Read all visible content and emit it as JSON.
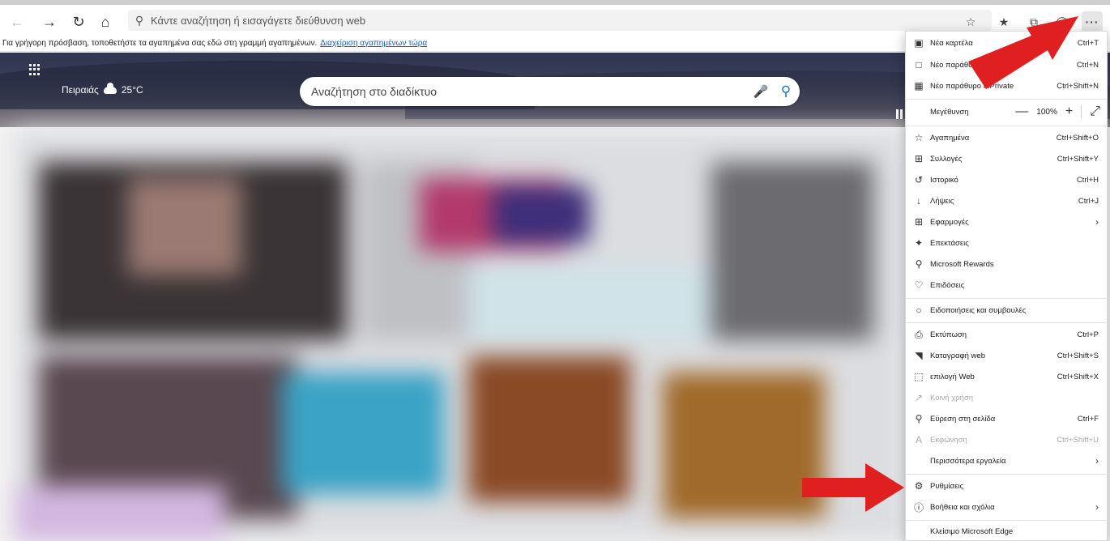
{
  "address_bar": {
    "placeholder": "Κάντε αναζήτηση ή εισαγάγετε διεύθυνση web"
  },
  "favorites_bar": {
    "text": "Για γρήγορη πρόσβαση, τοποθετήστε τα αγαπημένα σας εδώ στη γραμμή αγαπημένων.",
    "link": "Διαχείριση αγαπημένων τώρα"
  },
  "weather": {
    "city": "Πειραιάς",
    "temp": "25°C"
  },
  "search": {
    "placeholder": "Αναζήτηση στο διαδίκτυο"
  },
  "menu": {
    "new_tab": {
      "label": "Νέα καρτέλα",
      "shortcut": "Ctrl+T"
    },
    "new_window": {
      "label": "Νέο παράθυρο",
      "shortcut": "Ctrl+N"
    },
    "new_inprivate": {
      "label": "Νέο παράθυρο InPrivate",
      "shortcut": "Ctrl+Shift+N"
    },
    "zoom": {
      "label": "Μεγέθυνση",
      "value": "100%"
    },
    "favorites": {
      "label": "Αγαπημένα",
      "shortcut": "Ctrl+Shift+O"
    },
    "collections": {
      "label": "Συλλογές",
      "shortcut": "Ctrl+Shift+Y"
    },
    "history": {
      "label": "Ιστορικό",
      "shortcut": "Ctrl+H"
    },
    "downloads": {
      "label": "Λήψεις",
      "shortcut": "Ctrl+J"
    },
    "apps": {
      "label": "Εφαρμογές"
    },
    "extensions": {
      "label": "Επεκτάσεις"
    },
    "rewards": {
      "label": "Microsoft Rewards"
    },
    "performance": {
      "label": "Επιδόσεις"
    },
    "notifications": {
      "label": "Ειδοποιήσεις και συμβουλές"
    },
    "print": {
      "label": "Εκτύπωση",
      "shortcut": "Ctrl+P"
    },
    "web_capture": {
      "label": "Καταγραφή web",
      "shortcut": "Ctrl+Shift+S"
    },
    "web_select": {
      "label": "επιλογή Web",
      "shortcut": "Ctrl+Shift+X"
    },
    "share": {
      "label": "Κοινή χρήση"
    },
    "find": {
      "label": "Εύρεση στη σελίδα",
      "shortcut": "Ctrl+F"
    },
    "read_aloud": {
      "label": "Εκφώνηση",
      "shortcut": "Ctrl+Shift+U"
    },
    "more_tools": {
      "label": "Περισσότερα εργαλεία"
    },
    "settings": {
      "label": "Ρυθμίσεις"
    },
    "help": {
      "label": "Βοήθεια και σχόλια"
    },
    "close_edge": {
      "label": "Κλείσιμο Microsoft Edge"
    }
  },
  "colors": {
    "accent": "#1a73c8",
    "arrow": "#e02020"
  },
  "icons": [
    "back-icon",
    "forward-icon",
    "refresh-icon",
    "home-icon",
    "search-icon",
    "favorites-star-icon",
    "favorites-list-icon",
    "collections-icon",
    "profile-icon",
    "more-icon",
    "apps-grid-icon",
    "cloud-icon",
    "mic-icon",
    "magnifier-icon",
    "pause-icon"
  ]
}
